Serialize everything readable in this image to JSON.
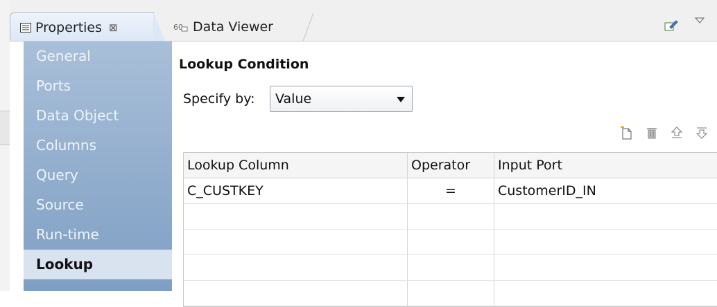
{
  "tabs": {
    "properties": {
      "label": "Properties",
      "close": "⊠"
    },
    "data_viewer": {
      "label": "Data Viewer"
    }
  },
  "nav": {
    "items": [
      {
        "label": "General"
      },
      {
        "label": "Ports"
      },
      {
        "label": "Data Object"
      },
      {
        "label": "Columns"
      },
      {
        "label": "Query"
      },
      {
        "label": "Source"
      },
      {
        "label": "Run-time"
      },
      {
        "label": "Lookup",
        "active": true
      }
    ]
  },
  "content": {
    "section_title": "Lookup Condition",
    "specify_label": "Specify by:",
    "specify_value": "Value",
    "toolbar_icons": [
      "new-row-icon",
      "delete-icon",
      "move-up-icon",
      "move-down-icon"
    ],
    "table": {
      "headers": [
        "Lookup Column",
        "Operator",
        "Input Port"
      ],
      "rows": [
        [
          "C_CUSTKEY",
          "=",
          "CustomerID_IN"
        ],
        [
          "",
          "",
          ""
        ],
        [
          "",
          "",
          ""
        ],
        [
          "",
          "",
          ""
        ],
        [
          "",
          "",
          ""
        ]
      ]
    }
  },
  "colors": {
    "nav_gradient_top": "#a9bfd8",
    "nav_gradient_bottom": "#7e9fc4",
    "nav_active_bg": "#d9e3ef",
    "tab_active_bg": "#dce7f7"
  }
}
